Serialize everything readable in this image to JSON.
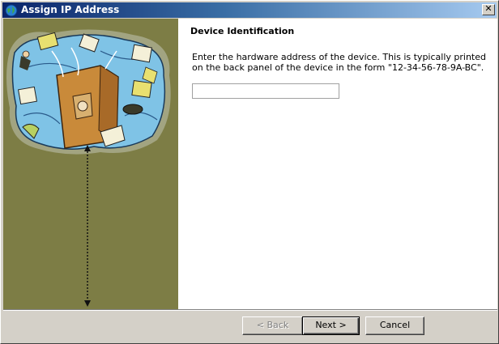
{
  "window": {
    "title": "Assign IP Address",
    "close_glyph": "✕"
  },
  "icons": {
    "title": "globe-icon",
    "close": "close-icon"
  },
  "content": {
    "heading": "Device Identification",
    "description": "Enter the hardware address of the device.  This is typically printed on the back panel of the device in the form \"12-34-56-78-9A-BC\".",
    "mac_value": "",
    "mac_placeholder": ""
  },
  "buttons": {
    "back": "< Back",
    "next": "Next >",
    "cancel": "Cancel"
  },
  "colors": {
    "title_gradient_start": "#0a246a",
    "title_gradient_end": "#a6caf0",
    "side_panel": "#7d7d45",
    "dialog_face": "#d4d0c8"
  }
}
